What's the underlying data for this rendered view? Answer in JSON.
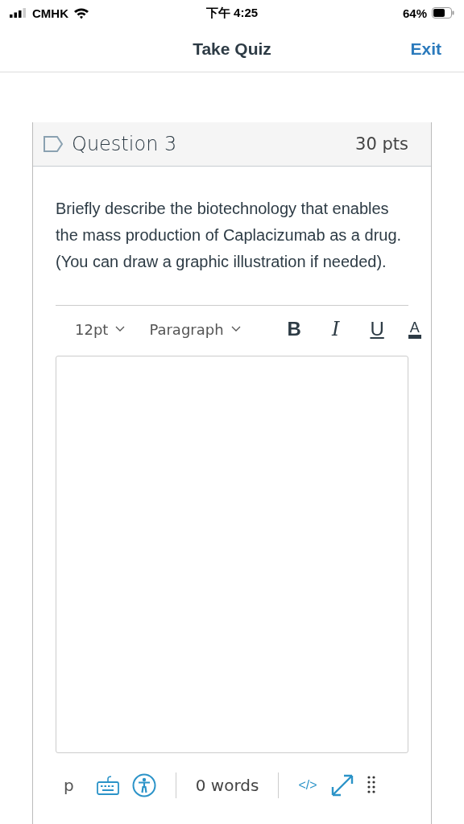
{
  "status_bar": {
    "carrier": "CMHK",
    "time": "下午 4:25",
    "battery": "64%"
  },
  "header": {
    "title": "Take Quiz",
    "exit": "Exit"
  },
  "question": {
    "title": "Question 3",
    "points": "30 pts",
    "text": "Briefly describe the biotechnology that enables the mass production of Caplacizumab as a drug. (You can draw a graphic illustration if needed)."
  },
  "toolbar": {
    "font_size": "12pt",
    "block": "Paragraph",
    "format_buttons": [
      {
        "kind": "bold",
        "label": "B"
      },
      {
        "kind": "italic",
        "label": "I"
      },
      {
        "kind": "underline",
        "label": "U"
      },
      {
        "kind": "color",
        "label": "A"
      }
    ]
  },
  "footer": {
    "path": "p",
    "words": "0 words",
    "html": "</>"
  }
}
